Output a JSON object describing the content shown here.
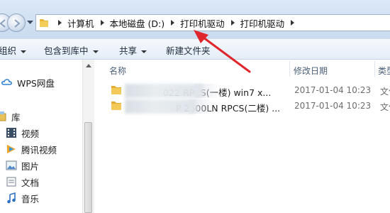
{
  "address_bar": {
    "crumbs": [
      "计算机",
      "本地磁盘 (D:)",
      "打印机驱动",
      "打印机驱动"
    ]
  },
  "toolbar": {
    "organize": "组织",
    "include_in_library": "包含到库中",
    "share": "共享",
    "new_folder": "新建文件夹"
  },
  "nav_pane": {
    "items": [
      {
        "label": "WPS网盘",
        "icon": "cloud-icon"
      },
      {
        "label": "库",
        "icon": "library-icon"
      },
      {
        "label": "视频",
        "icon": "video-icon"
      },
      {
        "label": "腾讯视频",
        "icon": "tencent-video-icon"
      },
      {
        "label": "图片",
        "icon": "picture-icon"
      },
      {
        "label": "文档",
        "icon": "document-icon"
      },
      {
        "label": "音乐",
        "icon": "music-icon"
      }
    ]
  },
  "file_list": {
    "columns": {
      "name": "名称",
      "modified": "修改日期",
      "type": "类型"
    },
    "rows": [
      {
        "name_visible": "022 RPCS(一楼) win7 x...",
        "modified": "2017-01-04  10:23",
        "type": "文件"
      },
      {
        "name_visible": "P 2500LN RPCS(二楼) ...",
        "modified": "2017-01-04  10:23",
        "type": "文件"
      }
    ]
  },
  "colors": {
    "annotation_arrow": "#e0262d",
    "folder_yellow": "#f0c24b",
    "toolbar_bg": "#e4edf7"
  }
}
